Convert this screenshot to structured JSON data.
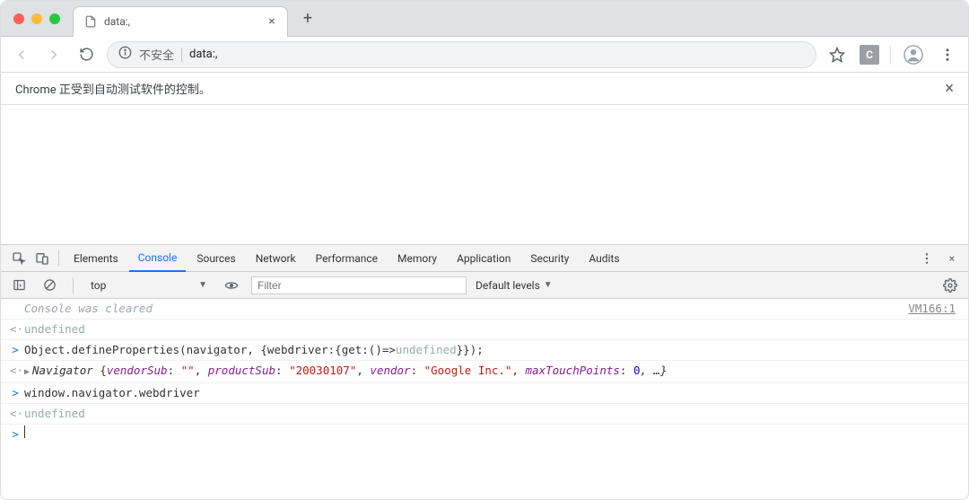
{
  "tab": {
    "title": "data:,"
  },
  "toolbar": {
    "insecure_label": "不安全",
    "url": "data:,",
    "ext_label": "C"
  },
  "infobar": {
    "message": "Chrome 正受到自动测试软件的控制。"
  },
  "devtools": {
    "tabs": [
      "Elements",
      "Console",
      "Sources",
      "Network",
      "Performance",
      "Memory",
      "Application",
      "Security",
      "Audits"
    ],
    "active_tab": "Console"
  },
  "console_toolbar": {
    "context": "top",
    "filter_placeholder": "Filter",
    "levels_label": "Default levels"
  },
  "console": {
    "cleared_msg": "Console was cleared",
    "cleared_src": "VM166:1",
    "line1": "undefined",
    "line2": {
      "pre": "Object.defineProperties(navigator, {webdriver:{get:()=>",
      "undef": "undefined",
      "post": "}});"
    },
    "line3": {
      "lead": "Navigator ",
      "k1": "vendorSub",
      "v1": "\"\"",
      "k2": "productSub",
      "v2": "\"20030107\"",
      "k3": "vendor",
      "v3": "\"Google Inc.\"",
      "k4": "maxTouchPoints",
      "v4": "0",
      "tail": ", …}"
    },
    "line4": "window.navigator.webdriver",
    "line5": "undefined"
  }
}
